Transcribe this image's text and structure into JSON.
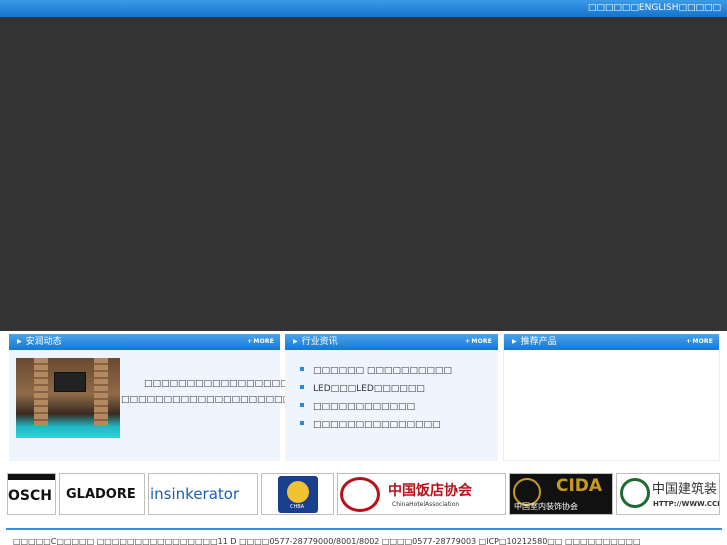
{
  "header": {
    "links": "□□□□□□ENGLISH□□□□□"
  },
  "panels": {
    "news": {
      "title": "安润动态",
      "more": "MORE",
      "text": "□□□□□□□□□□□□□□□□□□□□□□□□□□□□□□□□□□□□□□□□ □□□□□□□□□□□□□□□□□□□□□□□…"
    },
    "industry": {
      "title": "行业资讯",
      "more": "MORE",
      "items": [
        "□□□□□□ □□□□□□□□□□",
        "LED□□□LED□□□□□□",
        "□□□□□□□□□□□□",
        "□□□□□□□□□□□□□□□"
      ]
    },
    "products": {
      "title": "推荐产品",
      "more": "MORE"
    }
  },
  "logos": [
    {
      "text": "OSCH",
      "color": "#111111",
      "name": "bosch-logo"
    },
    {
      "text": "GLADORE",
      "color": "#111111",
      "name": "gladore-logo"
    },
    {
      "text": "insinkerator",
      "color": "#1b5fb0",
      "name": "insinkerator-logo"
    },
    {
      "text": "CHBA",
      "color": "#1b3f8f",
      "name": "chba-logo"
    },
    {
      "text": "中国饭店协会",
      "sub": "ChinaHotelAssociation",
      "color": "#b5121b",
      "name": "china-hotel-association-logo"
    },
    {
      "text": "CIDA",
      "sub": "中国室内装饰协会",
      "color": "#c89a1e",
      "name": "cida-logo"
    },
    {
      "text": "中国建筑装",
      "sub": "HTTP://WWW.CCD.",
      "color": "#1e6b32",
      "name": "ccd-logo"
    }
  ],
  "footer": {
    "text": "□□□□□C□□□□□ □□□□□□□□□□□□□□□□11 D □□□□0577-28779000/8001/8002 □□□□0577-28779003 □ICP□10212580□□ □□□□□□□□□□"
  }
}
